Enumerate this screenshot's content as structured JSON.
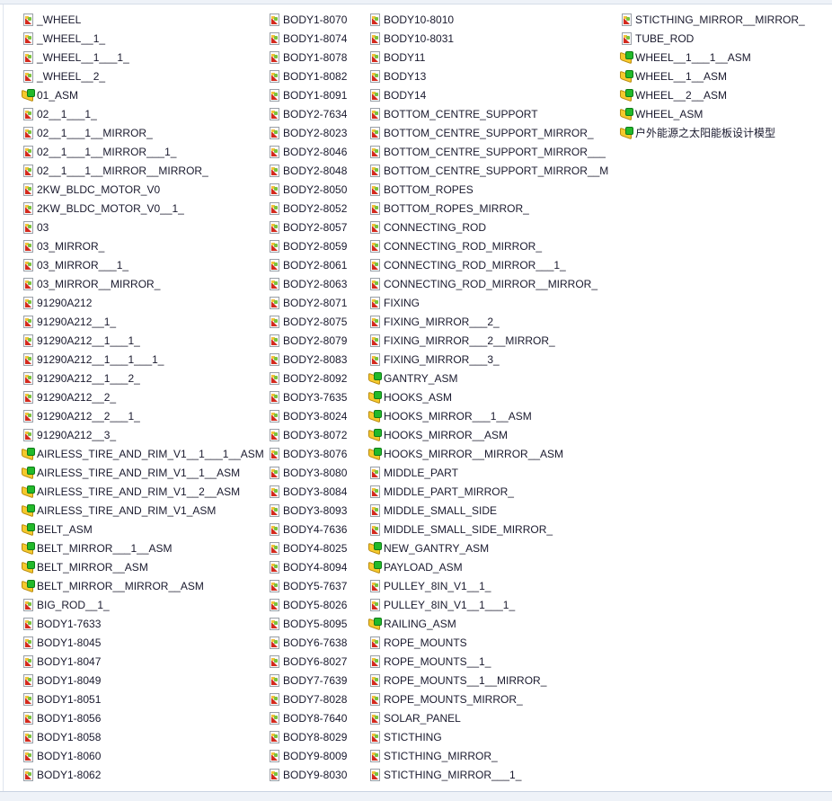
{
  "file_list": {
    "columns": [
      [
        {
          "name": "_WHEEL",
          "type": "part"
        },
        {
          "name": "_WHEEL__1_",
          "type": "part"
        },
        {
          "name": "_WHEEL__1___1_",
          "type": "part"
        },
        {
          "name": "_WHEEL__2_",
          "type": "part"
        },
        {
          "name": "01_ASM",
          "type": "asm"
        },
        {
          "name": "02__1___1_",
          "type": "part"
        },
        {
          "name": "02__1___1__MIRROR_",
          "type": "part"
        },
        {
          "name": "02__1___1__MIRROR___1_",
          "type": "part"
        },
        {
          "name": "02__1___1__MIRROR__MIRROR_",
          "type": "part"
        },
        {
          "name": "2KW_BLDC_MOTOR_V0",
          "type": "part"
        },
        {
          "name": "2KW_BLDC_MOTOR_V0__1_",
          "type": "part"
        },
        {
          "name": "03",
          "type": "part"
        },
        {
          "name": "03_MIRROR_",
          "type": "part"
        },
        {
          "name": "03_MIRROR___1_",
          "type": "part"
        },
        {
          "name": "03_MIRROR__MIRROR_",
          "type": "part"
        },
        {
          "name": "91290A212",
          "type": "part"
        },
        {
          "name": "91290A212__1_",
          "type": "part"
        },
        {
          "name": "91290A212__1___1_",
          "type": "part"
        },
        {
          "name": "91290A212__1___1___1_",
          "type": "part"
        },
        {
          "name": "91290A212__1___2_",
          "type": "part"
        },
        {
          "name": "91290A212__2_",
          "type": "part"
        },
        {
          "name": "91290A212__2___1_",
          "type": "part"
        },
        {
          "name": "91290A212__3_",
          "type": "part"
        },
        {
          "name": "AIRLESS_TIRE_AND_RIM_V1__1___1__ASM",
          "type": "asm"
        },
        {
          "name": "AIRLESS_TIRE_AND_RIM_V1__1__ASM",
          "type": "asm"
        },
        {
          "name": "AIRLESS_TIRE_AND_RIM_V1__2__ASM",
          "type": "asm"
        },
        {
          "name": "AIRLESS_TIRE_AND_RIM_V1_ASM",
          "type": "asm"
        },
        {
          "name": "BELT_ASM",
          "type": "asm"
        },
        {
          "name": "BELT_MIRROR___1__ASM",
          "type": "asm"
        },
        {
          "name": "BELT_MIRROR__ASM",
          "type": "asm"
        },
        {
          "name": "BELT_MIRROR__MIRROR__ASM",
          "type": "asm"
        },
        {
          "name": "BIG_ROD__1_",
          "type": "part"
        },
        {
          "name": "BODY1-7633",
          "type": "part"
        },
        {
          "name": "BODY1-8045",
          "type": "part"
        },
        {
          "name": "BODY1-8047",
          "type": "part"
        },
        {
          "name": "BODY1-8049",
          "type": "part"
        },
        {
          "name": "BODY1-8051",
          "type": "part"
        },
        {
          "name": "BODY1-8056",
          "type": "part"
        },
        {
          "name": "BODY1-8058",
          "type": "part"
        },
        {
          "name": "BODY1-8060",
          "type": "part"
        },
        {
          "name": "BODY1-8062",
          "type": "part"
        }
      ],
      [
        {
          "name": "BODY1-8070",
          "type": "part"
        },
        {
          "name": "BODY1-8074",
          "type": "part"
        },
        {
          "name": "BODY1-8078",
          "type": "part"
        },
        {
          "name": "BODY1-8082",
          "type": "part"
        },
        {
          "name": "BODY1-8091",
          "type": "part"
        },
        {
          "name": "BODY2-7634",
          "type": "part"
        },
        {
          "name": "BODY2-8023",
          "type": "part"
        },
        {
          "name": "BODY2-8046",
          "type": "part"
        },
        {
          "name": "BODY2-8048",
          "type": "part"
        },
        {
          "name": "BODY2-8050",
          "type": "part"
        },
        {
          "name": "BODY2-8052",
          "type": "part"
        },
        {
          "name": "BODY2-8057",
          "type": "part"
        },
        {
          "name": "BODY2-8059",
          "type": "part"
        },
        {
          "name": "BODY2-8061",
          "type": "part"
        },
        {
          "name": "BODY2-8063",
          "type": "part"
        },
        {
          "name": "BODY2-8071",
          "type": "part"
        },
        {
          "name": "BODY2-8075",
          "type": "part"
        },
        {
          "name": "BODY2-8079",
          "type": "part"
        },
        {
          "name": "BODY2-8083",
          "type": "part"
        },
        {
          "name": "BODY2-8092",
          "type": "part"
        },
        {
          "name": "BODY3-7635",
          "type": "part"
        },
        {
          "name": "BODY3-8024",
          "type": "part"
        },
        {
          "name": "BODY3-8072",
          "type": "part"
        },
        {
          "name": "BODY3-8076",
          "type": "part"
        },
        {
          "name": "BODY3-8080",
          "type": "part"
        },
        {
          "name": "BODY3-8084",
          "type": "part"
        },
        {
          "name": "BODY3-8093",
          "type": "part"
        },
        {
          "name": "BODY4-7636",
          "type": "part"
        },
        {
          "name": "BODY4-8025",
          "type": "part"
        },
        {
          "name": "BODY4-8094",
          "type": "part"
        },
        {
          "name": "BODY5-7637",
          "type": "part"
        },
        {
          "name": "BODY5-8026",
          "type": "part"
        },
        {
          "name": "BODY5-8095",
          "type": "part"
        },
        {
          "name": "BODY6-7638",
          "type": "part"
        },
        {
          "name": "BODY6-8027",
          "type": "part"
        },
        {
          "name": "BODY7-7639",
          "type": "part"
        },
        {
          "name": "BODY7-8028",
          "type": "part"
        },
        {
          "name": "BODY8-7640",
          "type": "part"
        },
        {
          "name": "BODY8-8029",
          "type": "part"
        },
        {
          "name": "BODY9-8009",
          "type": "part"
        },
        {
          "name": "BODY9-8030",
          "type": "part"
        }
      ],
      [
        {
          "name": "BODY10-8010",
          "type": "part"
        },
        {
          "name": "BODY10-8031",
          "type": "part"
        },
        {
          "name": "BODY11",
          "type": "part"
        },
        {
          "name": "BODY13",
          "type": "part"
        },
        {
          "name": "BODY14",
          "type": "part"
        },
        {
          "name": "BOTTOM_CENTRE_SUPPORT",
          "type": "part"
        },
        {
          "name": "BOTTOM_CENTRE_SUPPORT_MIRROR_",
          "type": "part"
        },
        {
          "name": "BOTTOM_CENTRE_SUPPORT_MIRROR___",
          "type": "part"
        },
        {
          "name": "BOTTOM_CENTRE_SUPPORT_MIRROR__M",
          "type": "part"
        },
        {
          "name": "BOTTOM_ROPES",
          "type": "part"
        },
        {
          "name": "BOTTOM_ROPES_MIRROR_",
          "type": "part"
        },
        {
          "name": "CONNECTING_ROD",
          "type": "part"
        },
        {
          "name": "CONNECTING_ROD_MIRROR_",
          "type": "part"
        },
        {
          "name": "CONNECTING_ROD_MIRROR___1_",
          "type": "part"
        },
        {
          "name": "CONNECTING_ROD_MIRROR__MIRROR_",
          "type": "part"
        },
        {
          "name": "FIXING",
          "type": "part"
        },
        {
          "name": "FIXING_MIRROR___2_",
          "type": "part"
        },
        {
          "name": "FIXING_MIRROR___2__MIRROR_",
          "type": "part"
        },
        {
          "name": "FIXING_MIRROR___3_",
          "type": "part"
        },
        {
          "name": "GANTRY_ASM",
          "type": "asm"
        },
        {
          "name": "HOOKS_ASM",
          "type": "asm"
        },
        {
          "name": "HOOKS_MIRROR___1__ASM",
          "type": "asm"
        },
        {
          "name": "HOOKS_MIRROR__ASM",
          "type": "asm"
        },
        {
          "name": "HOOKS_MIRROR__MIRROR__ASM",
          "type": "asm"
        },
        {
          "name": "MIDDLE_PART",
          "type": "part"
        },
        {
          "name": "MIDDLE_PART_MIRROR_",
          "type": "part"
        },
        {
          "name": "MIDDLE_SMALL_SIDE",
          "type": "part"
        },
        {
          "name": "MIDDLE_SMALL_SIDE_MIRROR_",
          "type": "part"
        },
        {
          "name": "NEW_GANTRY_ASM",
          "type": "asm"
        },
        {
          "name": "PAYLOAD_ASM",
          "type": "asm"
        },
        {
          "name": "PULLEY_8IN_V1__1_",
          "type": "part"
        },
        {
          "name": "PULLEY_8IN_V1__1___1_",
          "type": "part"
        },
        {
          "name": "RAILING_ASM",
          "type": "asm"
        },
        {
          "name": "ROPE_MOUNTS",
          "type": "part"
        },
        {
          "name": "ROPE_MOUNTS__1_",
          "type": "part"
        },
        {
          "name": "ROPE_MOUNTS__1__MIRROR_",
          "type": "part"
        },
        {
          "name": "ROPE_MOUNTS_MIRROR_",
          "type": "part"
        },
        {
          "name": "SOLAR_PANEL",
          "type": "part"
        },
        {
          "name": "STICTHING",
          "type": "part"
        },
        {
          "name": "STICTHING_MIRROR_",
          "type": "part"
        },
        {
          "name": "STICTHING_MIRROR___1_",
          "type": "part"
        }
      ],
      [
        {
          "name": "STICTHING_MIRROR__MIRROR_",
          "type": "part"
        },
        {
          "name": "TUBE_ROD",
          "type": "part"
        },
        {
          "name": "WHEEL__1___1__ASM",
          "type": "asm"
        },
        {
          "name": "WHEEL__1__ASM",
          "type": "asm"
        },
        {
          "name": "WHEEL__2__ASM",
          "type": "asm"
        },
        {
          "name": "WHEEL_ASM",
          "type": "asm"
        },
        {
          "name": "户外能源之太阳能板设计模型",
          "type": "asm"
        }
      ]
    ]
  }
}
